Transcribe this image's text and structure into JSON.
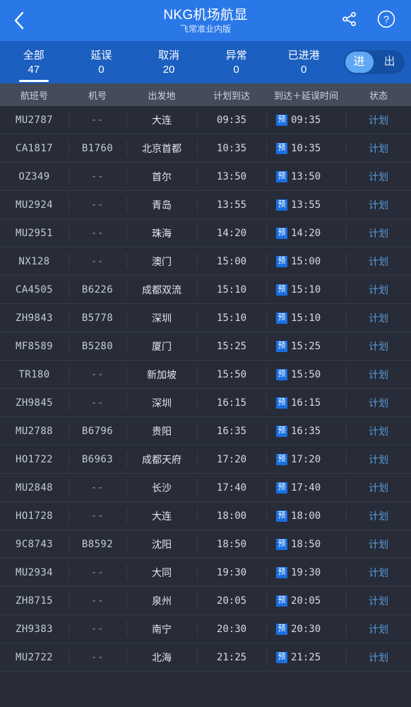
{
  "topbar": {
    "back_icon": "chevron-left-icon",
    "title": "NKG机场航显",
    "subtitle": "飞常准业内版",
    "share_icon": "share-icon",
    "help_icon": "help-circle-icon",
    "bg_color": "#2a78e8"
  },
  "stats": {
    "bg_color": "#1b5fc0",
    "items": [
      {
        "label": "全部",
        "value": "47",
        "active": true
      },
      {
        "label": "延误",
        "value": "0",
        "active": false
      },
      {
        "label": "取消",
        "value": "20",
        "active": false
      },
      {
        "label": "异常",
        "value": "0",
        "active": false
      },
      {
        "label": "已进港",
        "value": "0",
        "active": false
      }
    ],
    "toggle": {
      "arrivals_label": "进",
      "departures_label": "出",
      "selected": "进",
      "knob_color": "#5fa8f5"
    }
  },
  "table": {
    "header_bg": "#454b59",
    "status_color": "#5b9bd9",
    "badge_color": "#1a6fe0",
    "columns": [
      "航班号",
      "机号",
      "出发地",
      "计划到达",
      "到达＋延误时间",
      "状态"
    ],
    "rows": [
      {
        "flight": "MU2787",
        "tail": "--",
        "origin": "大连",
        "scheduled": "09:35",
        "badge": "预",
        "eta": "09:35",
        "status": "计划"
      },
      {
        "flight": "CA1817",
        "tail": "B1760",
        "origin": "北京首都",
        "scheduled": "10:35",
        "badge": "预",
        "eta": "10:35",
        "status": "计划"
      },
      {
        "flight": "OZ349",
        "tail": "--",
        "origin": "首尔",
        "scheduled": "13:50",
        "badge": "预",
        "eta": "13:50",
        "status": "计划"
      },
      {
        "flight": "MU2924",
        "tail": "--",
        "origin": "青岛",
        "scheduled": "13:55",
        "badge": "预",
        "eta": "13:55",
        "status": "计划"
      },
      {
        "flight": "MU2951",
        "tail": "--",
        "origin": "珠海",
        "scheduled": "14:20",
        "badge": "预",
        "eta": "14:20",
        "status": "计划"
      },
      {
        "flight": "NX128",
        "tail": "--",
        "origin": "澳门",
        "scheduled": "15:00",
        "badge": "预",
        "eta": "15:00",
        "status": "计划"
      },
      {
        "flight": "CA4505",
        "tail": "B6226",
        "origin": "成都双流",
        "scheduled": "15:10",
        "badge": "预",
        "eta": "15:10",
        "status": "计划"
      },
      {
        "flight": "ZH9843",
        "tail": "B5778",
        "origin": "深圳",
        "scheduled": "15:10",
        "badge": "预",
        "eta": "15:10",
        "status": "计划"
      },
      {
        "flight": "MF8589",
        "tail": "B5280",
        "origin": "厦门",
        "scheduled": "15:25",
        "badge": "预",
        "eta": "15:25",
        "status": "计划"
      },
      {
        "flight": "TR180",
        "tail": "--",
        "origin": "新加坡",
        "scheduled": "15:50",
        "badge": "预",
        "eta": "15:50",
        "status": "计划"
      },
      {
        "flight": "ZH9845",
        "tail": "--",
        "origin": "深圳",
        "scheduled": "16:15",
        "badge": "预",
        "eta": "16:15",
        "status": "计划"
      },
      {
        "flight": "MU2788",
        "tail": "B6796",
        "origin": "贵阳",
        "scheduled": "16:35",
        "badge": "预",
        "eta": "16:35",
        "status": "计划"
      },
      {
        "flight": "HO1722",
        "tail": "B6963",
        "origin": "成都天府",
        "scheduled": "17:20",
        "badge": "预",
        "eta": "17:20",
        "status": "计划"
      },
      {
        "flight": "MU2848",
        "tail": "--",
        "origin": "长沙",
        "scheduled": "17:40",
        "badge": "预",
        "eta": "17:40",
        "status": "计划"
      },
      {
        "flight": "HO1728",
        "tail": "--",
        "origin": "大连",
        "scheduled": "18:00",
        "badge": "预",
        "eta": "18:00",
        "status": "计划"
      },
      {
        "flight": "9C8743",
        "tail": "B8592",
        "origin": "沈阳",
        "scheduled": "18:50",
        "badge": "预",
        "eta": "18:50",
        "status": "计划"
      },
      {
        "flight": "MU2934",
        "tail": "--",
        "origin": "大同",
        "scheduled": "19:30",
        "badge": "预",
        "eta": "19:30",
        "status": "计划"
      },
      {
        "flight": "ZH8715",
        "tail": "--",
        "origin": "泉州",
        "scheduled": "20:05",
        "badge": "预",
        "eta": "20:05",
        "status": "计划"
      },
      {
        "flight": "ZH9383",
        "tail": "--",
        "origin": "南宁",
        "scheduled": "20:30",
        "badge": "预",
        "eta": "20:30",
        "status": "计划"
      },
      {
        "flight": "MU2722",
        "tail": "--",
        "origin": "北海",
        "scheduled": "21:25",
        "badge": "预",
        "eta": "21:25",
        "status": "计划"
      }
    ]
  }
}
